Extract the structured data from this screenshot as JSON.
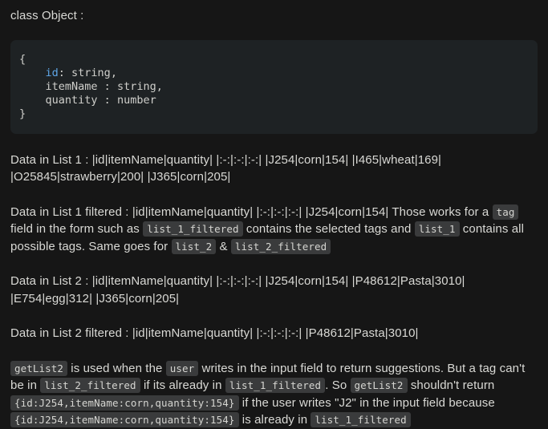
{
  "document": {
    "intro_line": "class Object :",
    "code_block": {
      "language": "text",
      "open_brace": "{",
      "close_brace": "}",
      "fields": [
        {
          "key": "id",
          "sep": ": ",
          "type": "string,"
        },
        {
          "key": "itemName",
          "sep": " : ",
          "type": "string,"
        },
        {
          "key": "quantity",
          "sep": " : ",
          "type": "number"
        }
      ],
      "key_color": "#5fa7e8",
      "text_color": "#cfcfcb",
      "background": "#1e2224"
    },
    "paragraphs": [
      {
        "id": "list-1-data",
        "segments": [
          {
            "kind": "text",
            "value": "Data in List 1 : |id|itemName|quantity| |:-:|:-:|:-:| |J254|corn|154| |I465|wheat|169| |O25845|strawberry|200| |J365|corn|205|"
          }
        ]
      },
      {
        "id": "list-1-filtered-data",
        "segments": [
          {
            "kind": "text",
            "value": "Data in List 1 filtered : |id|itemName|quantity| |:-:|:-:|:-:| |J254|corn|154| Those works for a "
          },
          {
            "kind": "code",
            "value": "tag"
          },
          {
            "kind": "text",
            "value": " field in the form such as "
          },
          {
            "kind": "code",
            "value": "list_1_filtered"
          },
          {
            "kind": "text",
            "value": " contains the selected tags and "
          },
          {
            "kind": "code",
            "value": "list_1"
          },
          {
            "kind": "text",
            "value": " contains all possible tags. Same goes for "
          },
          {
            "kind": "code",
            "value": "list_2"
          },
          {
            "kind": "text",
            "value": " & "
          },
          {
            "kind": "code",
            "value": "list_2_filtered"
          }
        ]
      },
      {
        "id": "list-2-data",
        "segments": [
          {
            "kind": "text",
            "value": "Data in List 2 : |id|itemName|quantity| |:-:|:-:|:-:| |J254|corn|154| |P48612|Pasta|3010| |E754|egg|312| |J365|corn|205|"
          }
        ]
      },
      {
        "id": "list-2-filtered-data",
        "segments": [
          {
            "kind": "text",
            "value": "Data in List 2 filtered : |id|itemName|quantity| |:-:|:-:|:-:| |P48612|Pasta|3010|"
          }
        ]
      },
      {
        "id": "getlist2-explanation",
        "segments": [
          {
            "kind": "code",
            "value": "getList2"
          },
          {
            "kind": "text",
            "value": " is used when the "
          },
          {
            "kind": "code",
            "value": "user"
          },
          {
            "kind": "text",
            "value": " writes in the input field to return suggestions. But a tag can't be in "
          },
          {
            "kind": "code",
            "value": "list_2_filtered"
          },
          {
            "kind": "text",
            "value": " if its already in "
          },
          {
            "kind": "code",
            "value": "list_1_filtered"
          },
          {
            "kind": "text",
            "value": ". So "
          },
          {
            "kind": "code",
            "value": "getList2"
          },
          {
            "kind": "text",
            "value": " shouldn't return "
          },
          {
            "kind": "code",
            "value": "{id:J254,itemName:corn,quantity:154}"
          },
          {
            "kind": "text",
            "value": " if the user writes \"J2\" in the input field because "
          },
          {
            "kind": "code",
            "value": "{id:J254,itemName:corn,quantity:154}"
          },
          {
            "kind": "text",
            "value": " is already in "
          },
          {
            "kind": "code",
            "value": "list_1_filtered"
          }
        ]
      }
    ],
    "theme": {
      "page_background": "#161616",
      "body_text": "#d9d9d5",
      "inline_code_background": "#3a3b3c",
      "inline_code_text": "#d5d5d1"
    }
  }
}
